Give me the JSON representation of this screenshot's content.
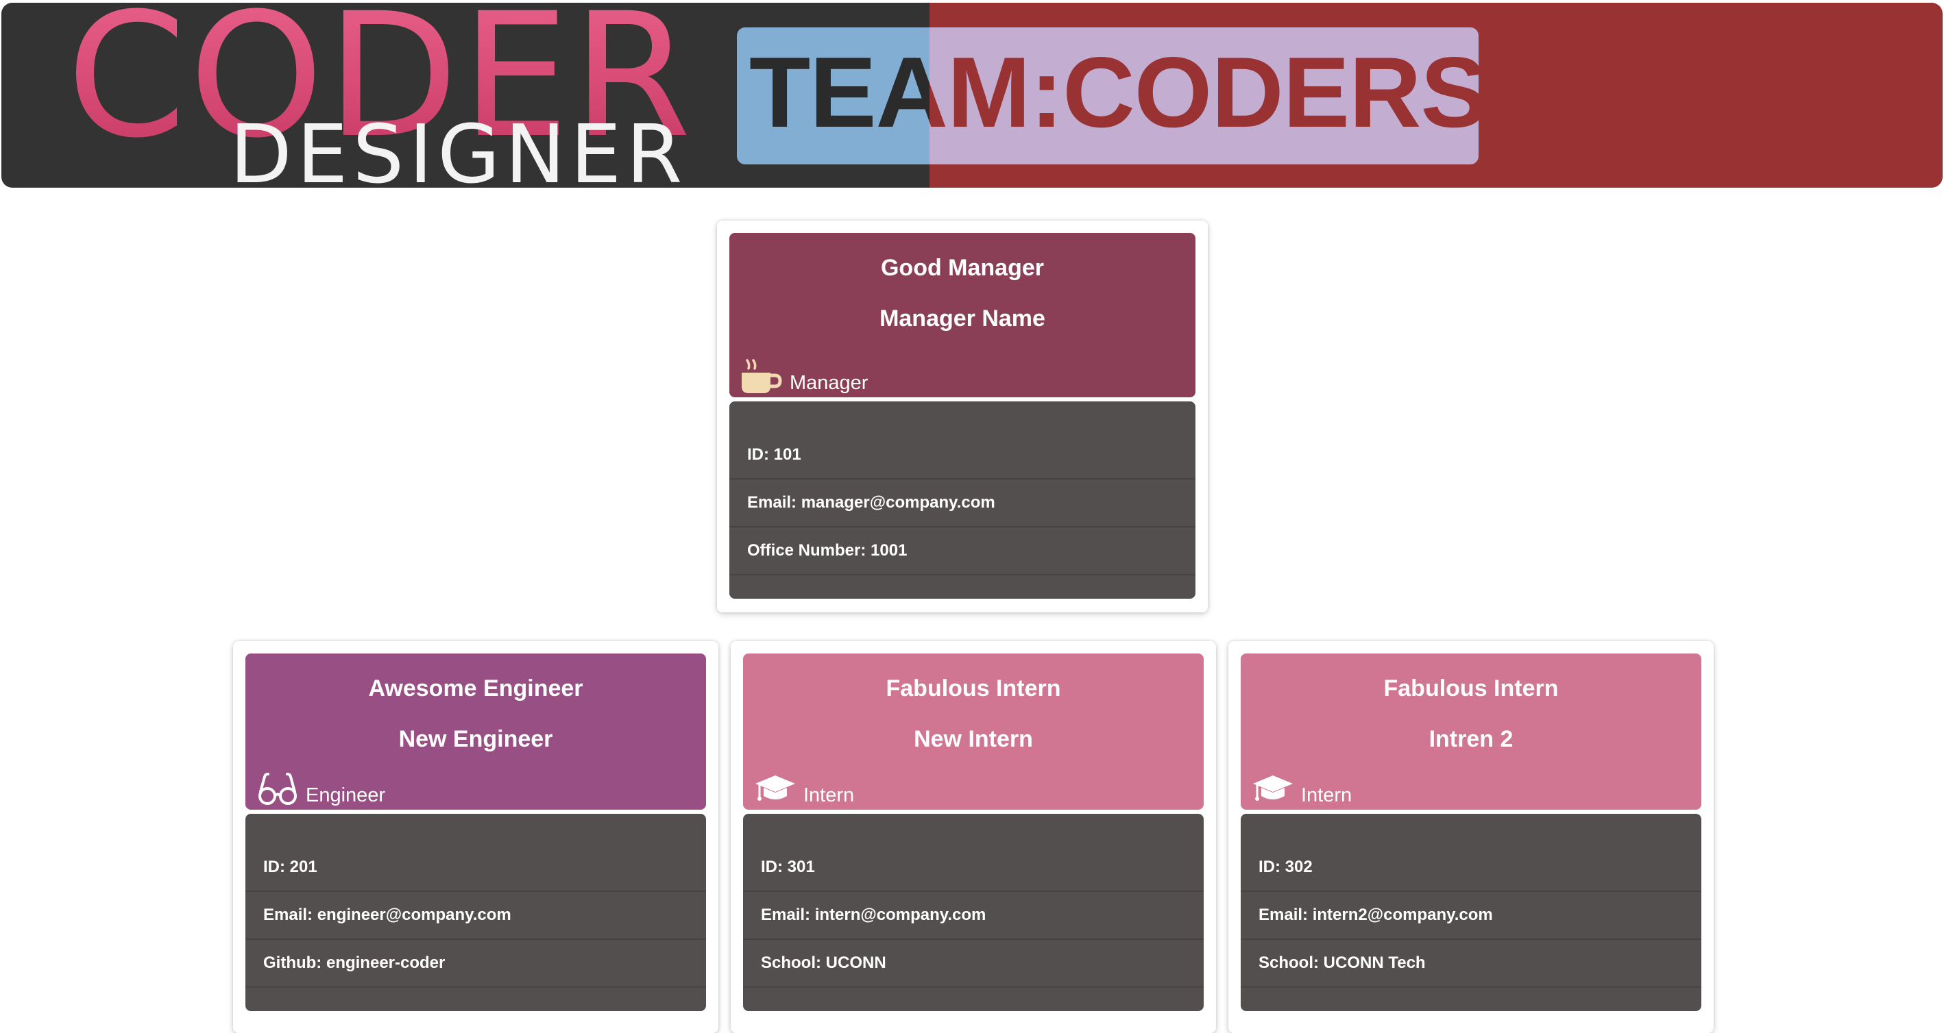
{
  "header": {
    "logo_word_top": "CODER",
    "logo_word_bottom": "DESIGNER",
    "team_title": "TEAM:CODERS"
  },
  "colors": {
    "banner_dark": "#333333",
    "banner_red": "#993333",
    "manager_head": "#8a3f57",
    "engineer_head": "#985084",
    "intern_head": "#d07592",
    "card_body": "#524f4e",
    "icon_cream": "#f2dbb0"
  },
  "manager": {
    "title": "Good Manager",
    "name": "Manager Name",
    "role": "Manager",
    "icon": "coffee-cup-icon",
    "id_label": "ID: ",
    "id": "101",
    "email_label": "Email: ",
    "email": "manager@company.com",
    "extra_label": "Office Number: ",
    "extra": "1001"
  },
  "engineer": {
    "title": "Awesome Engineer",
    "name": "New Engineer",
    "role": "Engineer",
    "icon": "glasses-icon",
    "id_label": "ID: ",
    "id": "201",
    "email_label": "Email: ",
    "email": "engineer@company.com",
    "extra_label": "Github: ",
    "extra": "engineer-coder"
  },
  "intern1": {
    "title": "Fabulous Intern",
    "name": "New Intern",
    "role": "Intern",
    "icon": "graduation-cap-icon",
    "id_label": "ID: ",
    "id": "301",
    "email_label": "Email: ",
    "email": "intern@company.com",
    "extra_label": "School: ",
    "extra": "UCONN"
  },
  "intern2": {
    "title": "Fabulous Intern",
    "name": "Intren 2",
    "role": "Intern",
    "icon": "graduation-cap-icon",
    "id_label": "ID: ",
    "id": "302",
    "email_label": "Email: ",
    "email": "intern2@company.com",
    "extra_label": "School: ",
    "extra": "UCONN Tech"
  }
}
